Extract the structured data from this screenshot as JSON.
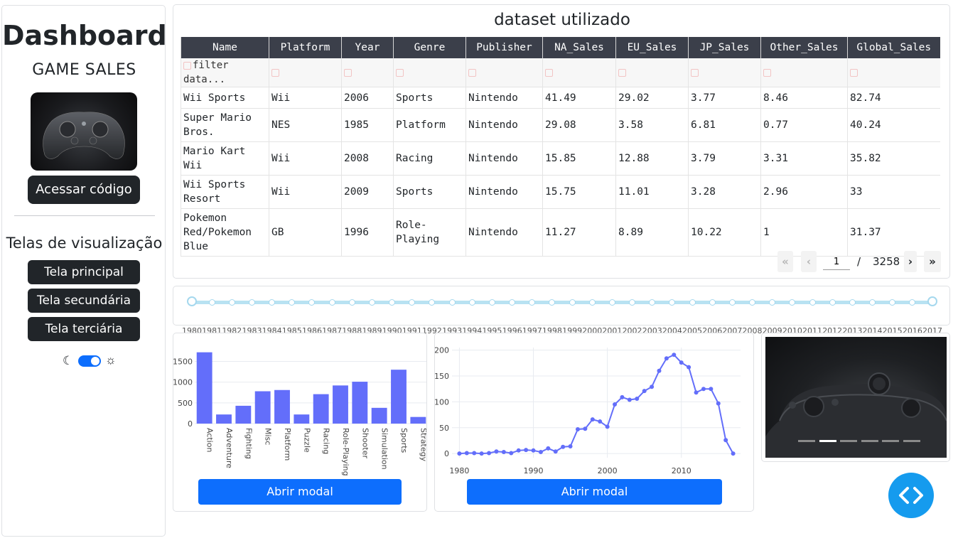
{
  "sidebar": {
    "title": "Dashboard",
    "subtitle": "GAME SALES",
    "code_button": "Acessar código",
    "views_heading": "Telas de visualização",
    "view_buttons": [
      "Tela principal",
      "Tela secundária",
      "Tela terciária"
    ],
    "theme_toggle_on": true
  },
  "table": {
    "title": "dataset utilizado",
    "columns": [
      "Name",
      "Platform",
      "Year",
      "Genre",
      "Publisher",
      "NA_Sales",
      "EU_Sales",
      "JP_Sales",
      "Other_Sales",
      "Global_Sales"
    ],
    "filter_placeholder": "filter data...",
    "rows": [
      [
        "Wii Sports",
        "Wii",
        "2006",
        "Sports",
        "Nintendo",
        "41.49",
        "29.02",
        "3.77",
        "8.46",
        "82.74"
      ],
      [
        "Super Mario Bros.",
        "NES",
        "1985",
        "Platform",
        "Nintendo",
        "29.08",
        "3.58",
        "6.81",
        "0.77",
        "40.24"
      ],
      [
        "Mario Kart Wii",
        "Wii",
        "2008",
        "Racing",
        "Nintendo",
        "15.85",
        "12.88",
        "3.79",
        "3.31",
        "35.82"
      ],
      [
        "Wii Sports Resort",
        "Wii",
        "2009",
        "Sports",
        "Nintendo",
        "15.75",
        "11.01",
        "3.28",
        "2.96",
        "33"
      ],
      [
        "Pokemon Red/Pokemon Blue",
        "GB",
        "1996",
        "Role-Playing",
        "Nintendo",
        "11.27",
        "8.89",
        "10.22",
        "1",
        "31.37"
      ]
    ],
    "pagination": {
      "current_page": "1",
      "separator": "/",
      "total_pages": "3258"
    }
  },
  "year_slider": {
    "range": [
      1980,
      2017
    ],
    "selected": [
      1980,
      2017
    ],
    "marks": [
      "1980",
      "1981",
      "1982",
      "1983",
      "1984",
      "1985",
      "1986",
      "1987",
      "1988",
      "1989",
      "1990",
      "1991",
      "1992",
      "1993",
      "1994",
      "1995",
      "1996",
      "1997",
      "1998",
      "1999",
      "2000",
      "2001",
      "2002",
      "2003",
      "2004",
      "2005",
      "2006",
      "2007",
      "2008",
      "2009",
      "2010",
      "2011",
      "2012",
      "2013",
      "2014",
      "2015",
      "2016",
      "2017"
    ],
    "accent": "#a5d8ee"
  },
  "charts": {
    "modal_button_label": "Abrir modal",
    "bar_color": "#636efa",
    "line_color": "#636efa"
  },
  "chart_data": [
    {
      "type": "bar",
      "categories": [
        "Action",
        "Adventure",
        "Fighting",
        "Misc",
        "Platform",
        "Puzzle",
        "Racing",
        "Role-Playing",
        "Shooter",
        "Simulation",
        "Sports",
        "Strategy"
      ],
      "values": [
        1720,
        220,
        430,
        780,
        810,
        220,
        710,
        920,
        1010,
        380,
        1300,
        160
      ],
      "ylim": [
        0,
        1800
      ],
      "yticks": [
        0,
        500,
        1000,
        1500
      ],
      "grid": true
    },
    {
      "type": "line",
      "x": [
        1980,
        1981,
        1982,
        1983,
        1984,
        1985,
        1986,
        1987,
        1988,
        1989,
        1990,
        1991,
        1992,
        1993,
        1994,
        1995,
        1996,
        1997,
        1998,
        1999,
        2000,
        2001,
        2002,
        2003,
        2004,
        2005,
        2006,
        2007,
        2008,
        2009,
        2010,
        2011,
        2012,
        2013,
        2014,
        2015,
        2016,
        2017
      ],
      "values": [
        0,
        1,
        1,
        0,
        1,
        4,
        3,
        1,
        6,
        7,
        6,
        3,
        10,
        4,
        13,
        14,
        47,
        48,
        66,
        62,
        52,
        95,
        109,
        104,
        106,
        121,
        129,
        160,
        184,
        191,
        176,
        167,
        118,
        125,
        125,
        97,
        26,
        0
      ],
      "xlim": [
        1979,
        2018
      ],
      "ylim": [
        -8,
        205
      ],
      "xticks": [
        1980,
        1990,
        2000,
        2010
      ],
      "yticks": [
        0,
        50,
        100,
        150,
        200
      ],
      "grid": true,
      "markers": true
    }
  ],
  "carousel": {
    "slide_count": 6,
    "active_index": 1
  },
  "fab": {
    "icon": "code-icon",
    "color": "#159bee"
  }
}
